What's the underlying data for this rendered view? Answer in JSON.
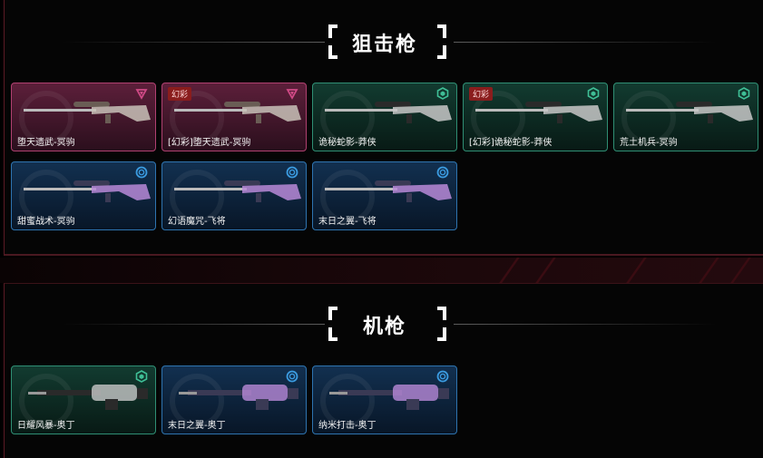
{
  "sections": [
    {
      "title": "狙击枪",
      "cards": [
        {
          "label": "堕天遗武-冥驹",
          "badge": "",
          "tier": "pink",
          "tier_icon": "triangle-icon"
        },
        {
          "label": "[幻彩]堕天遗武-冥驹",
          "badge": "幻彩",
          "tier": "pink",
          "tier_icon": "triangle-icon"
        },
        {
          "label": "诡秘蛇影-莽侠",
          "badge": "",
          "tier": "green",
          "tier_icon": "hexagon-icon"
        },
        {
          "label": "[幻彩]诡秘蛇影-莽侠",
          "badge": "幻彩",
          "tier": "green",
          "tier_icon": "hexagon-icon"
        },
        {
          "label": "荒土机兵-冥驹",
          "badge": "",
          "tier": "green",
          "tier_icon": "hexagon-icon"
        },
        {
          "label": "甜蜜战术-冥驹",
          "badge": "",
          "tier": "blue",
          "tier_icon": "circle-icon"
        },
        {
          "label": "幻语魔咒-飞将",
          "badge": "",
          "tier": "blue",
          "tier_icon": "circle-icon"
        },
        {
          "label": "末日之翼-飞将",
          "badge": "",
          "tier": "blue",
          "tier_icon": "circle-icon"
        }
      ]
    },
    {
      "title": "机枪",
      "cards": [
        {
          "label": "日耀风暴-奥丁",
          "badge": "",
          "tier": "green",
          "tier_icon": "hexagon-icon"
        },
        {
          "label": "末日之翼-奥丁",
          "badge": "",
          "tier": "blue",
          "tier_icon": "circle-icon"
        },
        {
          "label": "纳米打击-奥丁",
          "badge": "",
          "tier": "blue",
          "tier_icon": "circle-icon"
        }
      ]
    }
  ],
  "colors": {
    "pink": "#d04a86",
    "green": "#3fbf96",
    "blue": "#3b9be0",
    "badge": "#8a1d1d"
  }
}
